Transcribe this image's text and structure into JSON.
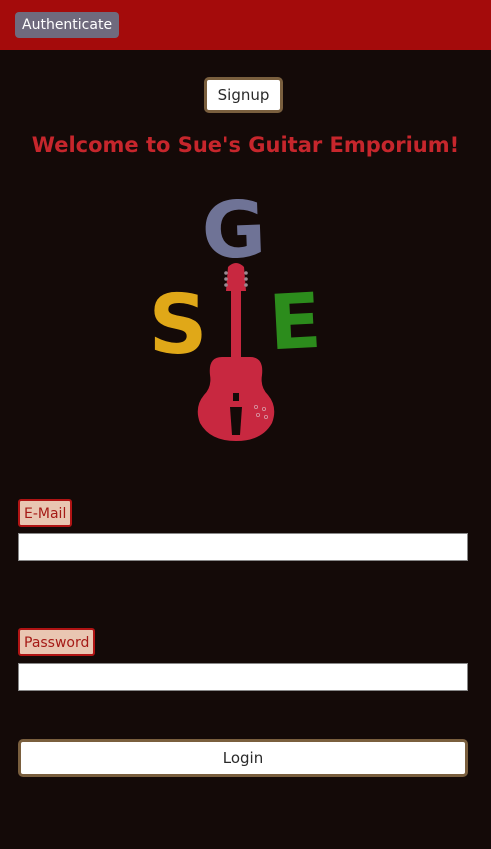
{
  "header": {
    "authenticate_label": "Authenticate"
  },
  "main": {
    "signup_label": "Signup",
    "welcome_text": "Welcome to Sue's Guitar Emporium!",
    "logo": {
      "letter_top": "G",
      "letter_left": "S",
      "letter_right": "E",
      "colors": {
        "g": "#6f7396",
        "s": "#e0a818",
        "e": "#2c8c1c",
        "guitar": "#c82840"
      }
    }
  },
  "form": {
    "email_label": "E-Mail",
    "email_value": "",
    "password_label": "Password",
    "password_value": "",
    "login_label": "Login"
  },
  "colors": {
    "header_bar": "#a40b0b",
    "background": "#140a08",
    "accent_text": "#c6262c"
  }
}
